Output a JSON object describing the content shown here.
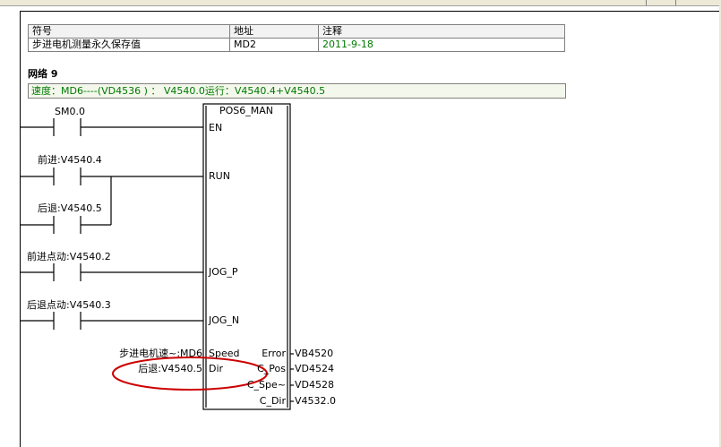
{
  "symbol_table": {
    "headers": [
      "符号",
      "地址",
      "注释"
    ],
    "rows": [
      {
        "symbol": "步进电机测量永久保存值",
        "address": "MD2",
        "comment": "2011-9-18"
      }
    ]
  },
  "network": {
    "title": "网络 9",
    "comment": "速度：MD6----(VD4536 ) ： V4540.0运行：V4540.4+V4540.5"
  },
  "box": {
    "name": "POS6_MAN",
    "inputs": [
      "EN",
      "RUN",
      "JOG_P",
      "JOG_N",
      "Speed",
      "Dir"
    ],
    "outputs": [
      "Error",
      "C_Pos",
      "C_Spe~",
      "C_Dir"
    ]
  },
  "contacts": [
    {
      "label": "SM0.0"
    },
    {
      "label": "前进:V4540.4"
    },
    {
      "label": "后退:V4540.5"
    },
    {
      "label": "前进点动:V4540.2"
    },
    {
      "label": "后退点动:V4540.3"
    }
  ],
  "operands": {
    "speed_in": "步进电机速~:MD6",
    "dir_in": "后退:V4540.5",
    "error_out": "VB4520",
    "cpos_out": "VD4524",
    "cspe_out": "VD4528",
    "cdir_out": "V4532.0"
  },
  "colors": {
    "comment_text": "#007a00",
    "annotation_ellipse": "#cc0000"
  }
}
